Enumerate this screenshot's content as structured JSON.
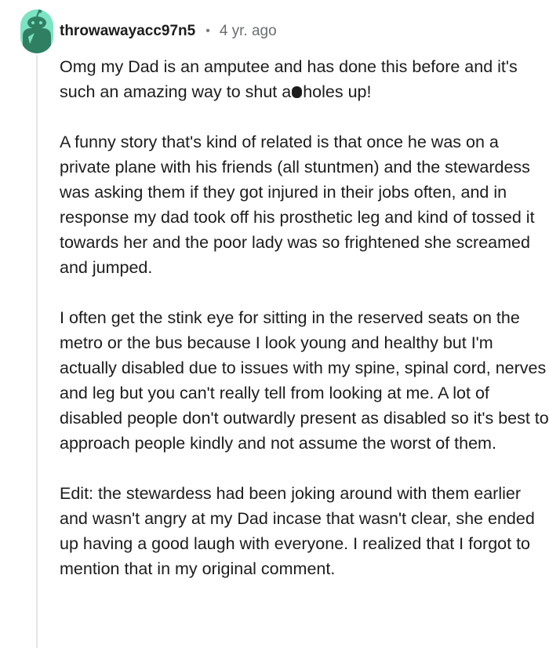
{
  "comment": {
    "username": "throwawayacc97n5",
    "separator": "•",
    "timestamp": "4 yr. ago",
    "avatar_color": "#7ce3c3",
    "paragraphs": [
      {
        "before_redaction": "Omg my Dad is an amputee and has done this before and it's such an amazing way to shut a",
        "after_redaction": "holes up!"
      },
      "A funny story that's kind of related is that once he was on a private plane with his friends (all stuntmen) and the stewardess was asking them if they got injured in their jobs often, and in response my dad took off his prosthetic leg and kind of tossed it towards her and the poor lady was so frightened she screamed and jumped.",
      "I often get the stink eye for sitting in the reserved seats on the metro or the bus because I look young and healthy but I'm actually disabled due to issues with my spine, spinal cord, nerves and leg but you can't really tell from looking at me. A lot of disabled people don't outwardly present as disabled so it's best to approach people kindly and not assume the worst of them.",
      "Edit: the stewardess had been joking around with them earlier and wasn't angry at my Dad incase that wasn't clear, she ended up having a good laugh with everyone. I realized that I forgot to mention that in my original comment."
    ]
  }
}
